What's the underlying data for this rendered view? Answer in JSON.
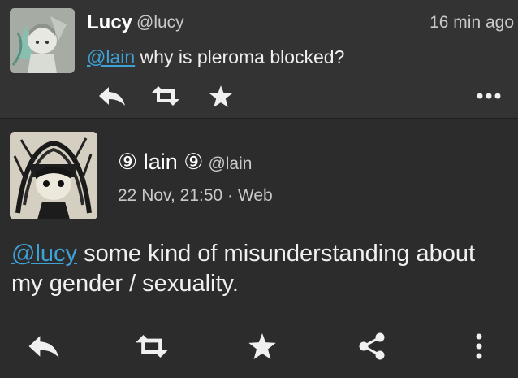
{
  "reply_post": {
    "display_name": "Lucy",
    "handle": "@lucy",
    "timestamp": "16 min ago",
    "mention": "@lain",
    "text": " why is pleroma blocked?"
  },
  "main_post": {
    "display_name": "⑨ lain ⑨",
    "handle": "@lain",
    "date": "22 Nov, 21:50",
    "separator": " · ",
    "client": "Web",
    "mention": "@lucy",
    "text": " some kind of misunderstanding about my gender / sexuality."
  },
  "icons": {
    "reply": "reply-icon",
    "repost": "repost-icon",
    "favorite": "star-icon",
    "share": "share-icon",
    "more_horizontal": "more-horizontal-icon",
    "more_vertical": "more-vertical-icon"
  },
  "colors": {
    "background": "#2c2c2c",
    "card": "#333333",
    "mention": "#3ea2d6"
  }
}
